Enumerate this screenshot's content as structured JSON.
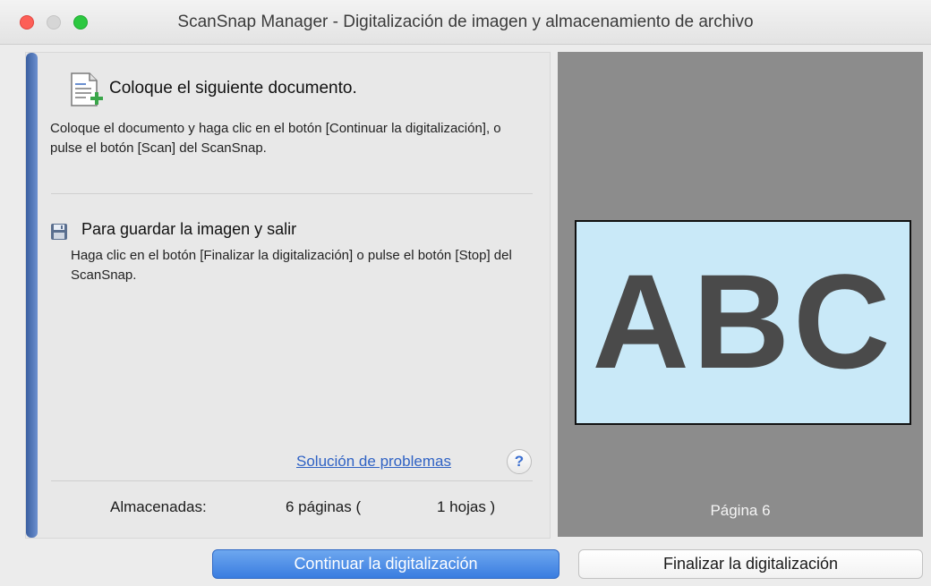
{
  "window": {
    "title": "ScanSnap Manager - Digitalización de imagen y almacenamiento de archivo"
  },
  "instruction": {
    "title": "Coloque el siguiente documento.",
    "description": "Coloque el documento y haga clic en el botón [Continuar la digitalización], o pulse el botón [Scan] del ScanSnap."
  },
  "save_section": {
    "title": "Para guardar la imagen y salir",
    "description": "Haga clic en el botón [Finalizar la digitalización] o pulse el botón [Stop] del ScanSnap."
  },
  "help": {
    "link_label": "Solución de problemas",
    "button_label": "?"
  },
  "stored": {
    "label": "Almacenadas:",
    "pages": "6 páginas (",
    "sheets": "1 hojas )"
  },
  "preview": {
    "thumbnail_text": "ABC",
    "page_label": "Página 6"
  },
  "buttons": {
    "continue_label": "Continuar la digitalización",
    "finish_label": "Finalizar la digitalización"
  },
  "icons": {
    "document": "document-add-icon",
    "save": "floppy-disk-icon",
    "help": "question-mark-icon"
  },
  "colors": {
    "accent": "#3a7de0",
    "link": "#2f62c4",
    "preview_background": "#8c8c8c",
    "thumbnail_background": "#c9e9f8"
  }
}
